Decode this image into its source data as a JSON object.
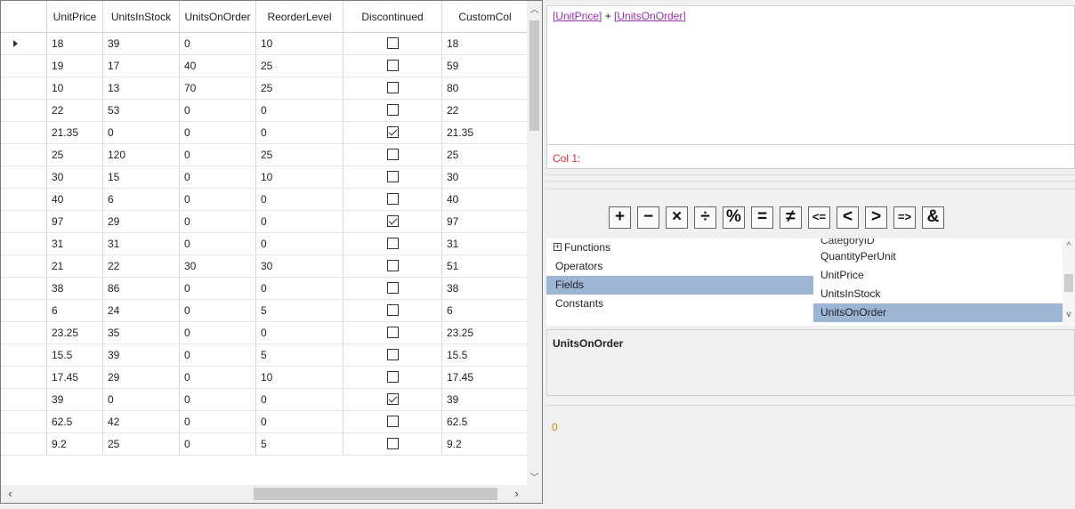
{
  "grid": {
    "columns": [
      "",
      "UnitPrice",
      "UnitsInStock",
      "UnitsOnOrder",
      "ReorderLevel",
      "Discontinued",
      "CustomCol"
    ],
    "rows": [
      {
        "unit_price": "18",
        "units_in_stock": "39",
        "units_on_order": "0",
        "reorder_level": "10",
        "discontinued": false,
        "custom_col": "18",
        "current": true
      },
      {
        "unit_price": "19",
        "units_in_stock": "17",
        "units_on_order": "40",
        "reorder_level": "25",
        "discontinued": false,
        "custom_col": "59"
      },
      {
        "unit_price": "10",
        "units_in_stock": "13",
        "units_on_order": "70",
        "reorder_level": "25",
        "discontinued": false,
        "custom_col": "80"
      },
      {
        "unit_price": "22",
        "units_in_stock": "53",
        "units_on_order": "0",
        "reorder_level": "0",
        "discontinued": false,
        "custom_col": "22"
      },
      {
        "unit_price": "21.35",
        "units_in_stock": "0",
        "units_on_order": "0",
        "reorder_level": "0",
        "discontinued": true,
        "custom_col": "21.35"
      },
      {
        "unit_price": "25",
        "units_in_stock": "120",
        "units_on_order": "0",
        "reorder_level": "25",
        "discontinued": false,
        "custom_col": "25"
      },
      {
        "unit_price": "30",
        "units_in_stock": "15",
        "units_on_order": "0",
        "reorder_level": "10",
        "discontinued": false,
        "custom_col": "30"
      },
      {
        "unit_price": "40",
        "units_in_stock": "6",
        "units_on_order": "0",
        "reorder_level": "0",
        "discontinued": false,
        "custom_col": "40"
      },
      {
        "unit_price": "97",
        "units_in_stock": "29",
        "units_on_order": "0",
        "reorder_level": "0",
        "discontinued": true,
        "custom_col": "97"
      },
      {
        "unit_price": "31",
        "units_in_stock": "31",
        "units_on_order": "0",
        "reorder_level": "0",
        "discontinued": false,
        "custom_col": "31"
      },
      {
        "unit_price": "21",
        "units_in_stock": "22",
        "units_on_order": "30",
        "reorder_level": "30",
        "discontinued": false,
        "custom_col": "51"
      },
      {
        "unit_price": "38",
        "units_in_stock": "86",
        "units_on_order": "0",
        "reorder_level": "0",
        "discontinued": false,
        "custom_col": "38"
      },
      {
        "unit_price": "6",
        "units_in_stock": "24",
        "units_on_order": "0",
        "reorder_level": "5",
        "discontinued": false,
        "custom_col": "6"
      },
      {
        "unit_price": "23.25",
        "units_in_stock": "35",
        "units_on_order": "0",
        "reorder_level": "0",
        "discontinued": false,
        "custom_col": "23.25"
      },
      {
        "unit_price": "15.5",
        "units_in_stock": "39",
        "units_on_order": "0",
        "reorder_level": "5",
        "discontinued": false,
        "custom_col": "15.5"
      },
      {
        "unit_price": "17.45",
        "units_in_stock": "29",
        "units_on_order": "0",
        "reorder_level": "10",
        "discontinued": false,
        "custom_col": "17.45"
      },
      {
        "unit_price": "39",
        "units_in_stock": "0",
        "units_on_order": "0",
        "reorder_level": "0",
        "discontinued": true,
        "custom_col": "39"
      },
      {
        "unit_price": "62.5",
        "units_in_stock": "42",
        "units_on_order": "0",
        "reorder_level": "0",
        "discontinued": false,
        "custom_col": "62.5"
      },
      {
        "unit_price": "9.2",
        "units_in_stock": "25",
        "units_on_order": "0",
        "reorder_level": "5",
        "discontinued": false,
        "custom_col": "9.2"
      }
    ],
    "scroll_up_icon": "chevron-up-icon",
    "scroll_down_icon": "chevron-down-icon",
    "scroll_left_icon": "chevron-left-icon",
    "scroll_right_icon": "chevron-right-icon"
  },
  "expression": {
    "field1": "[UnitPrice]",
    "operator": " + ",
    "field2": "[UnitsOnOrder]"
  },
  "error": {
    "text": "Col 1:"
  },
  "operators": [
    "+",
    "−",
    "×",
    "÷",
    "%",
    "=",
    "≠",
    "<=",
    "<",
    ">",
    "=>",
    "&"
  ],
  "categories": {
    "items": [
      "Functions",
      "Operators",
      "Fields",
      "Constants"
    ],
    "selected": "Fields",
    "expander": "⊞"
  },
  "fields": {
    "items": [
      "CategoryID",
      "QuantityPerUnit",
      "UnitPrice",
      "UnitsInStock",
      "UnitsOnOrder"
    ],
    "selected": "UnitsOnOrder"
  },
  "description": {
    "text": "UnitsOnOrder"
  },
  "result": {
    "text": "0"
  },
  "colors": {
    "field_token": "#9a2fb3",
    "error_text": "#e0282e",
    "selection": "#9db5d4",
    "result_text": "#c38b1d"
  }
}
